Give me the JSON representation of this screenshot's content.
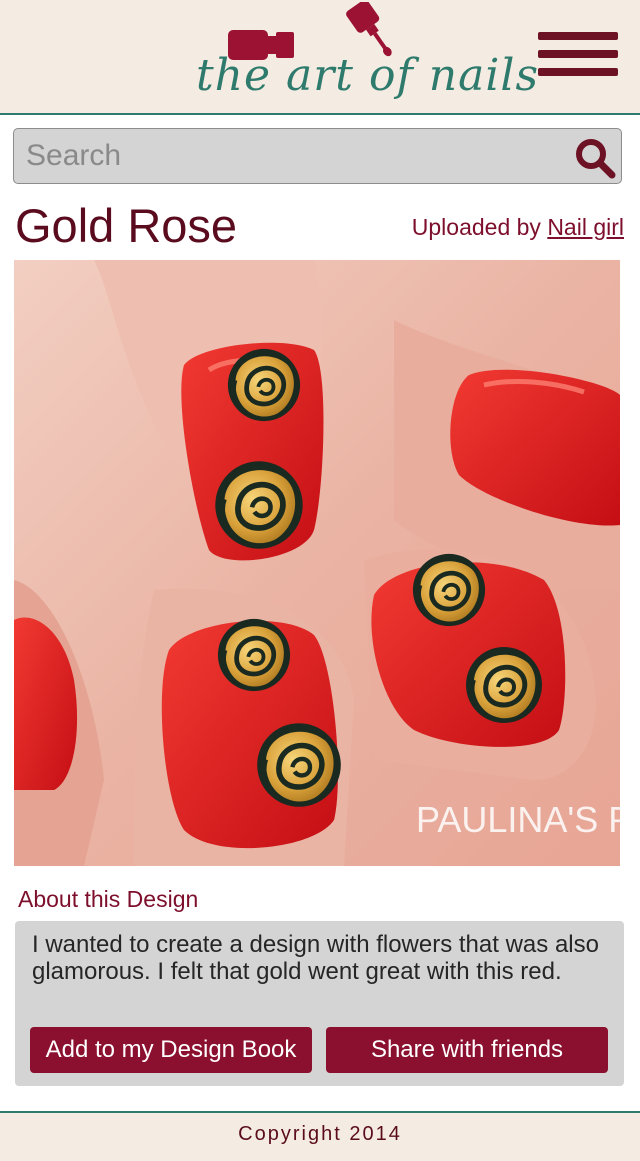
{
  "header": {
    "logo_text": "the art of nails",
    "menu_icon": "hamburger-menu-icon"
  },
  "search": {
    "placeholder": "Search",
    "value": "",
    "icon": "search-icon"
  },
  "design": {
    "title": "Gold Rose",
    "uploaded_by_prefix": "Uploaded by ",
    "uploader": "Nail girl",
    "photo_watermark": "PAULINA'S PAS"
  },
  "about": {
    "heading": "About this Design",
    "description": "I wanted to create a design with flowers that was also glamorous. I felt that gold went great with this red.",
    "add_button": "Add to my Design Book",
    "share_button": "Share with friends"
  },
  "footer": {
    "copyright": "Copyright 2014"
  },
  "colors": {
    "brand_maroon": "#6d1124",
    "button": "#8b0f2e",
    "accent_teal": "#2e7a6c",
    "header_bg": "#f4ece2"
  }
}
